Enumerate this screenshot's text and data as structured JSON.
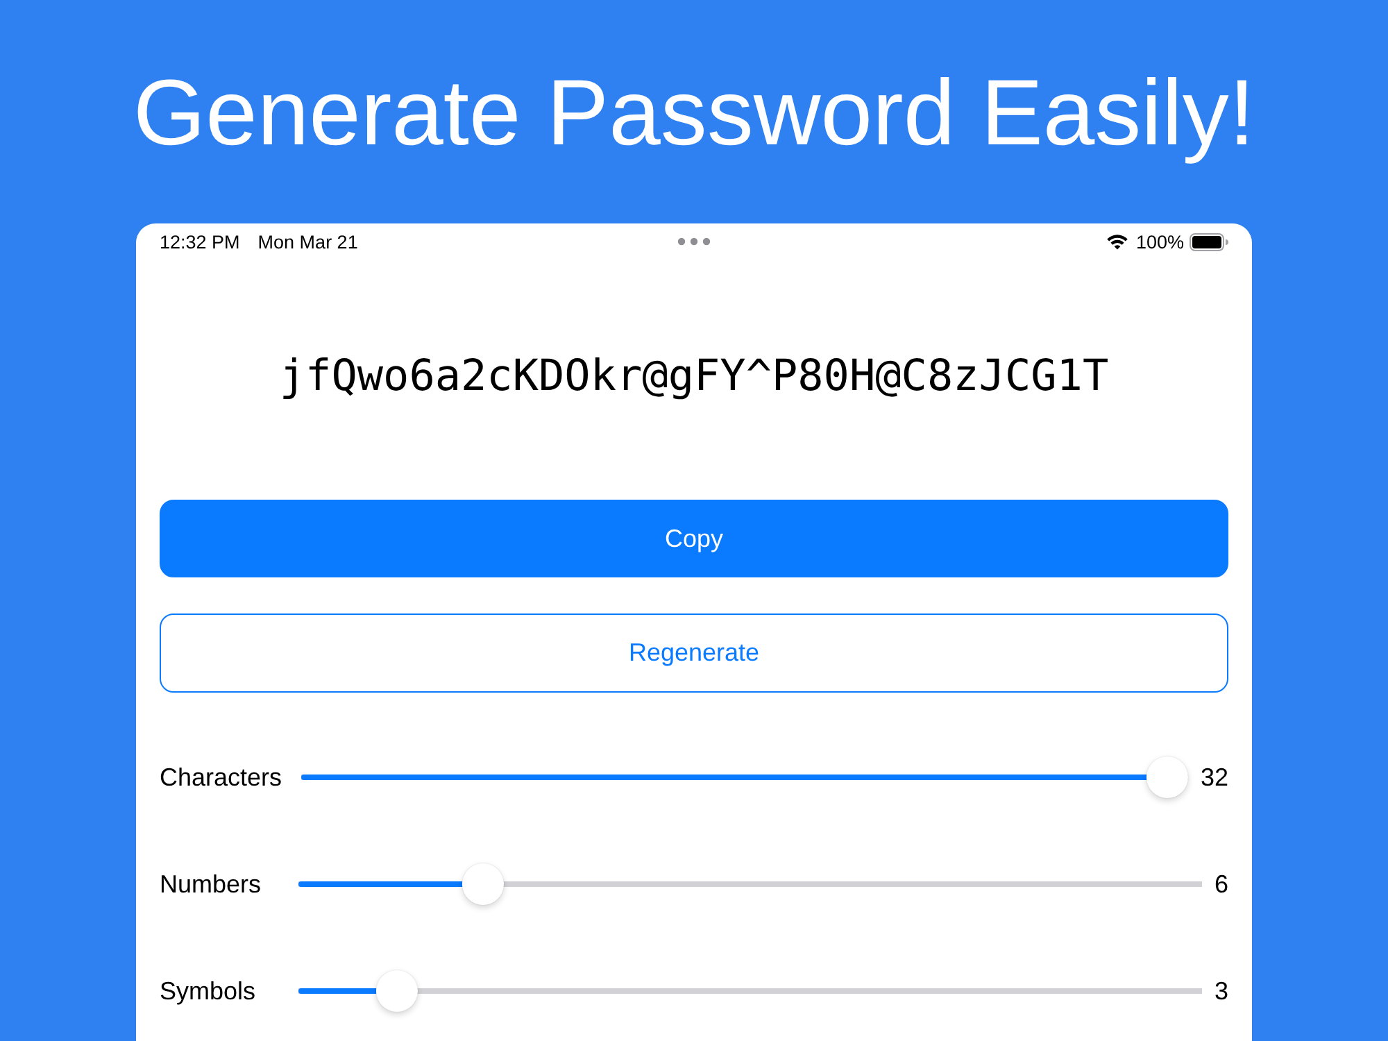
{
  "headline": "Generate Password Easily!",
  "status_bar": {
    "time": "12:32 PM",
    "date": "Mon Mar 21",
    "battery_text": "100%"
  },
  "password": "jfQwo6a2cKDOkr@gFY^P80H@C8zJCG1T",
  "buttons": [
    {
      "label": "Copy",
      "kind": "filled"
    },
    {
      "label": "Regenerate",
      "kind": "outlined"
    }
  ],
  "sliders": [
    {
      "label": "Characters",
      "level": 1,
      "value": "32"
    },
    {
      "label": "Numbers",
      "level": 0.19,
      "value": "6"
    },
    {
      "label": "Symbols",
      "level": 0.09,
      "value": "3"
    }
  ]
}
